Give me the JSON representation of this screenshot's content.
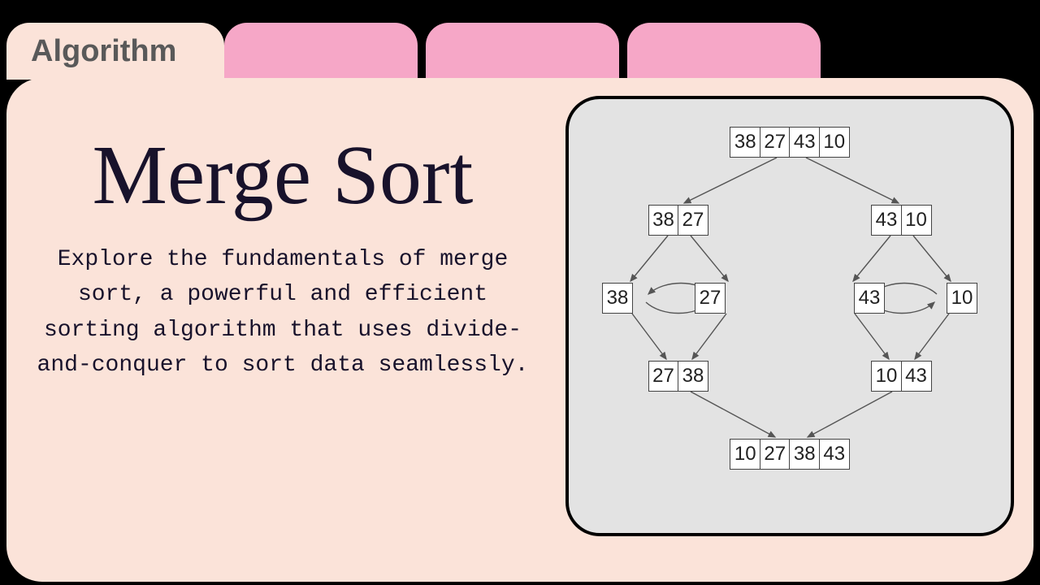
{
  "tabs": {
    "active_label": "Algorithm"
  },
  "content": {
    "title": "Merge Sort",
    "description": "Explore the fundamentals of merge sort, a powerful and efficient sorting algorithm that uses divide-and-conquer to sort data seamlessly."
  },
  "diagram": {
    "row1": [
      "38",
      "27",
      "43",
      "10"
    ],
    "row2_left": [
      "38",
      "27"
    ],
    "row2_right": [
      "43",
      "10"
    ],
    "row3_ll": [
      "38"
    ],
    "row3_lr": [
      "27"
    ],
    "row3_rl": [
      "43"
    ],
    "row3_rr": [
      "10"
    ],
    "row4_left": [
      "27",
      "38"
    ],
    "row4_right": [
      "10",
      "43"
    ],
    "row5": [
      "10",
      "27",
      "38",
      "43"
    ]
  }
}
